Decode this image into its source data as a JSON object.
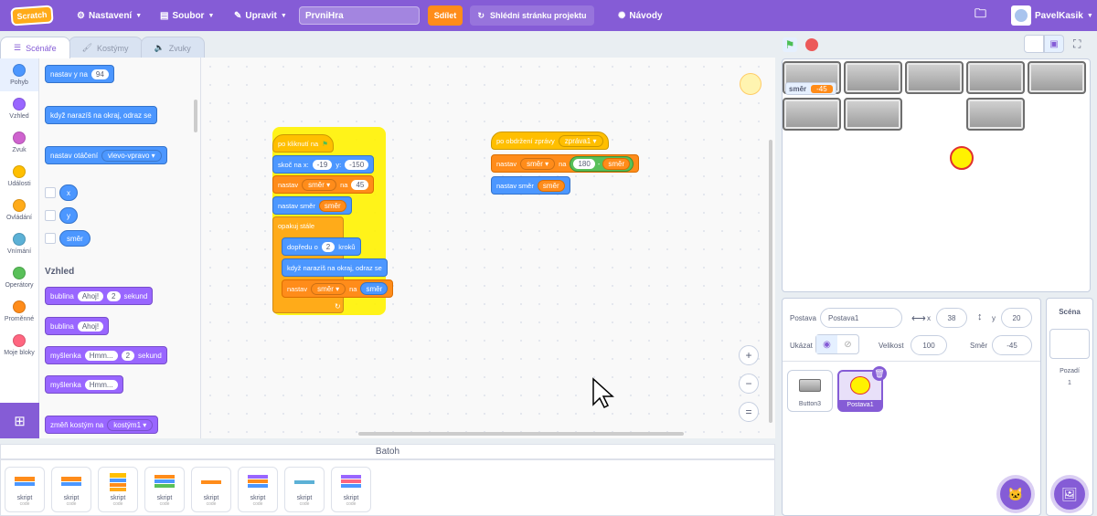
{
  "menubar": {
    "logo": "Scratch",
    "settings": "Nastavení",
    "file": "Soubor",
    "edit": "Upravit",
    "project_title": "PrvniHra",
    "share": "Sdílet",
    "see_project_page": "Shlédni stránku projektu",
    "tutorials": "Návody",
    "username": "PavelKasik"
  },
  "tabs": {
    "code": "Scénáře",
    "costumes": "Kostýmy",
    "sounds": "Zvuky"
  },
  "categories": [
    {
      "label": "Pohyb",
      "color": "#4c97ff"
    },
    {
      "label": "Vzhled",
      "color": "#9966ff"
    },
    {
      "label": "Zvuk",
      "color": "#cf63cf"
    },
    {
      "label": "Události",
      "color": "#ffbf00"
    },
    {
      "label": "Ovládání",
      "color": "#ffab19"
    },
    {
      "label": "Vnímání",
      "color": "#5cb1d6"
    },
    {
      "label": "Operátory",
      "color": "#59c059"
    },
    {
      "label": "Proměnné",
      "color": "#ff8c1a"
    },
    {
      "label": "Moje bloky",
      "color": "#ff6680"
    }
  ],
  "palette": {
    "set_y_label": "nastav y na",
    "set_y_value": "94",
    "bounce": "když narazíš na okraj, odraz se",
    "rotation_label": "nastav otáčení",
    "rotation_value": "vlevo-vpravo",
    "var_x": "x",
    "var_y": "y",
    "var_smer": "směr",
    "looks_header": "Vzhled",
    "say_for": "bublina",
    "say_for_text": "Ahoj!",
    "say_for_secs": "2",
    "say_for_unit": "sekund",
    "say": "bublina",
    "say_text": "Ahoj!",
    "think_for": "myšlenka",
    "think_for_text": "Hmm...",
    "think_for_secs": "2",
    "think_for_unit": "sekund",
    "think": "myšlenka",
    "think_text": "Hmm...",
    "switch_costume": "změň kostým na",
    "switch_costume_value": "kostým1"
  },
  "script1": {
    "hat": "po kliknutí na",
    "glide_label": "skoč na x:",
    "glide_x": "-19",
    "glide_y_label": "y:",
    "glide_y": "-150",
    "set_label": "nastav",
    "set_var": "směr",
    "set_to": "na",
    "set_value": "45",
    "point_label": "nastav směr",
    "point_value": "směr",
    "forever": "opakuj stále",
    "move_label": "dopředu o",
    "move_value": "2",
    "move_unit": "kroků",
    "bounce": "když narazíš na okraj, odraz se",
    "set2_label": "nastav",
    "set2_var": "směr",
    "set2_to": "na",
    "set2_value": "směr"
  },
  "script2": {
    "hat": "po obdržení zprávy",
    "hat_msg": "zpráva1",
    "set_label": "nastav",
    "set_var": "směr",
    "set_to": "na",
    "op_left": "180",
    "op_sign": "-",
    "op_right": "směr",
    "point_label": "nastav směr",
    "point_value": "směr"
  },
  "backpack": {
    "header": "Batoh",
    "items": [
      {
        "label": "skript",
        "sub": "code"
      },
      {
        "label": "skript",
        "sub": "code"
      },
      {
        "label": "skript",
        "sub": "code"
      },
      {
        "label": "skript",
        "sub": "code"
      },
      {
        "label": "skript",
        "sub": "code"
      },
      {
        "label": "skript",
        "sub": "code"
      },
      {
        "label": "skript",
        "sub": "code"
      },
      {
        "label": "skript",
        "sub": "code"
      }
    ]
  },
  "stage": {
    "monitor_label": "směr",
    "monitor_value": "-45"
  },
  "sprite_info": {
    "sprite_label": "Postava",
    "sprite_name": "Postava1",
    "x_label": "x",
    "x_value": "38",
    "y_label": "y",
    "y_value": "20",
    "show_label": "Ukázat",
    "size_label": "Velikost",
    "size_value": "100",
    "direction_label": "Směr",
    "direction_value": "-45"
  },
  "sprites": [
    {
      "name": "Button3"
    },
    {
      "name": "Postava1"
    }
  ],
  "scene": {
    "title": "Scéna",
    "backdrops_label": "Pozadí",
    "backdrops_count": "1"
  }
}
